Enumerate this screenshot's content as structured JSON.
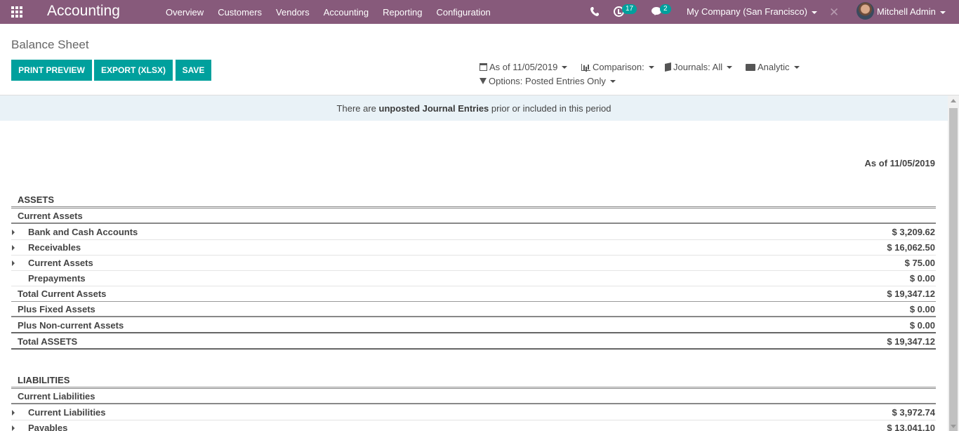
{
  "app": {
    "name": "Accounting",
    "menu": [
      "Overview",
      "Customers",
      "Vendors",
      "Accounting",
      "Reporting",
      "Configuration"
    ],
    "activity_count": "17",
    "message_count": "2",
    "company": "My Company (San Francisco)",
    "user": "Mitchell Admin"
  },
  "page": {
    "title": "Balance Sheet",
    "buttons": {
      "print": "PRINT PREVIEW",
      "export": "EXPORT (XLSX)",
      "save": "SAVE"
    },
    "filters": {
      "date": "As of 11/05/2019",
      "comparison": "Comparison:",
      "journals": "Journals: All",
      "analytic": "Analytic",
      "options": "Options: Posted Entries Only"
    },
    "alert": {
      "prefix": "There are ",
      "strong": "unposted Journal Entries",
      "suffix": " prior or included in this period"
    }
  },
  "report": {
    "date_header": "As of 11/05/2019",
    "assets": {
      "heading": "ASSETS",
      "current_heading": "Current Assets",
      "rows": [
        {
          "label": "Bank and Cash Accounts",
          "value": "$ 3,209.62"
        },
        {
          "label": "Receivables",
          "value": "$ 16,062.50"
        },
        {
          "label": "Current Assets",
          "value": "$ 75.00"
        },
        {
          "label": "Prepayments",
          "value": "$ 0.00"
        }
      ],
      "total_current": {
        "label": "Total Current Assets",
        "value": "$ 19,347.12"
      },
      "fixed": {
        "label": "Plus Fixed Assets",
        "value": "$ 0.00"
      },
      "noncurrent": {
        "label": "Plus Non-current Assets",
        "value": "$ 0.00"
      },
      "total": {
        "label": "Total ASSETS",
        "value": "$ 19,347.12"
      }
    },
    "liabilities": {
      "heading": "LIABILITIES",
      "current_heading": "Current Liabilities",
      "rows": [
        {
          "label": "Current Liabilities",
          "value": "$ 3,972.74"
        },
        {
          "label": "Payables",
          "value": "$ 13,041.10"
        }
      ]
    }
  }
}
